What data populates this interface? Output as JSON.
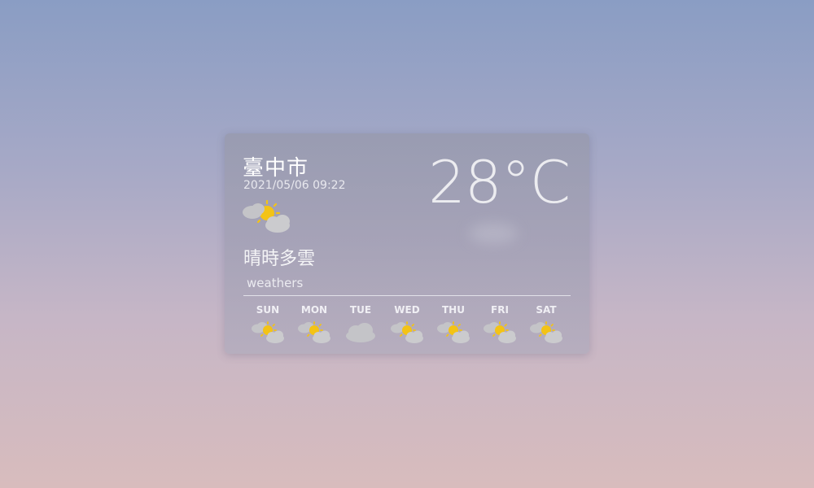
{
  "card": {
    "city": "臺中市",
    "datetime": "2021/05/06 09:22",
    "temperature": "28°C",
    "description": "晴時多雲",
    "subtitle": "weathers",
    "current_icon": "partly-cloudy-icon"
  },
  "forecast": [
    {
      "day": "SUN",
      "icon": "partly-cloudy-icon"
    },
    {
      "day": "MON",
      "icon": "partly-cloudy-icon"
    },
    {
      "day": "TUE",
      "icon": "cloud-icon"
    },
    {
      "day": "WED",
      "icon": "partly-cloudy-icon"
    },
    {
      "day": "THU",
      "icon": "partly-cloudy-icon"
    },
    {
      "day": "FRI",
      "icon": "partly-cloudy-icon"
    },
    {
      "day": "SAT",
      "icon": "partly-cloudy-icon"
    }
  ],
  "colors": {
    "sun": "#f3c316",
    "cloud": "#c4c4c8",
    "text": "#ffffff"
  }
}
